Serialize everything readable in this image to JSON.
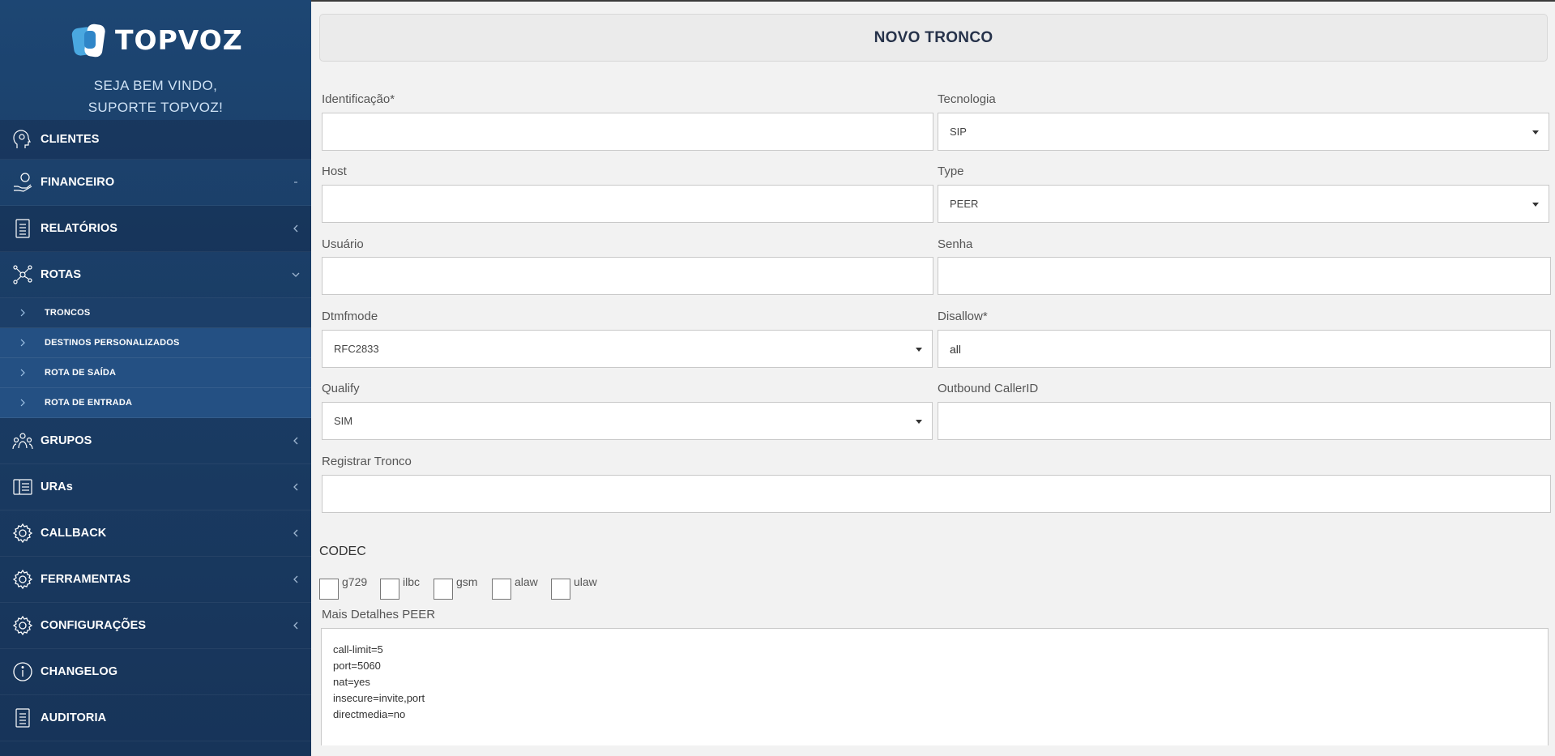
{
  "brand": {
    "name": "TOPVOZ"
  },
  "welcome": {
    "line1": "SEJA BEM VINDO,",
    "line2": "SUPORTE TOPVOZ!"
  },
  "menu": {
    "clientes": "CLIENTES",
    "financeiro": "FINANCEIRO",
    "relatorios": "RELATÓRIOS",
    "rotas": "ROTAS",
    "rotas_sub": [
      "TRONCOS",
      "DESTINOS PERSONALIZADOS",
      "ROTA DE SAÍDA",
      "ROTA DE ENTRADA"
    ],
    "grupos": "GRUPOS",
    "uras": "URAs",
    "callback": "CALLBACK",
    "ferramentas": "FERRAMENTAS",
    "configuracoes": "CONFIGURAÇÕES",
    "changelog": "CHANGELOG",
    "auditoria": "AUDITORIA"
  },
  "page": {
    "title": "NOVO TRONCO"
  },
  "form": {
    "identificacao": {
      "label": "Identificação*",
      "value": ""
    },
    "tecnologia": {
      "label": "Tecnologia",
      "value": "SIP"
    },
    "host": {
      "label": "Host",
      "value": ""
    },
    "type": {
      "label": "Type",
      "value": "PEER"
    },
    "usuario": {
      "label": "Usuário",
      "value": ""
    },
    "senha": {
      "label": "Senha",
      "value": ""
    },
    "dtmfmode": {
      "label": "Dtmfmode",
      "value": "RFC2833"
    },
    "disallow": {
      "label": "Disallow*",
      "value": "all"
    },
    "qualify": {
      "label": "Qualify",
      "value": "SIM"
    },
    "outbound": {
      "label": "Outbound CallerID",
      "value": ""
    },
    "registrar": {
      "label": "Registrar Tronco",
      "value": ""
    }
  },
  "codec": {
    "title": "CODEC",
    "options": [
      "g729",
      "ilbc",
      "gsm",
      "alaw",
      "ulaw"
    ]
  },
  "details": {
    "label": "Mais Detalhes PEER",
    "lines": [
      "call-limit=5",
      "port=5060",
      "nat=yes",
      "insecure=invite,port",
      "directmedia=no"
    ]
  },
  "colors": {
    "sidebar": "#1d4673",
    "accent": "#4aa8e0",
    "title": "#26324a"
  }
}
